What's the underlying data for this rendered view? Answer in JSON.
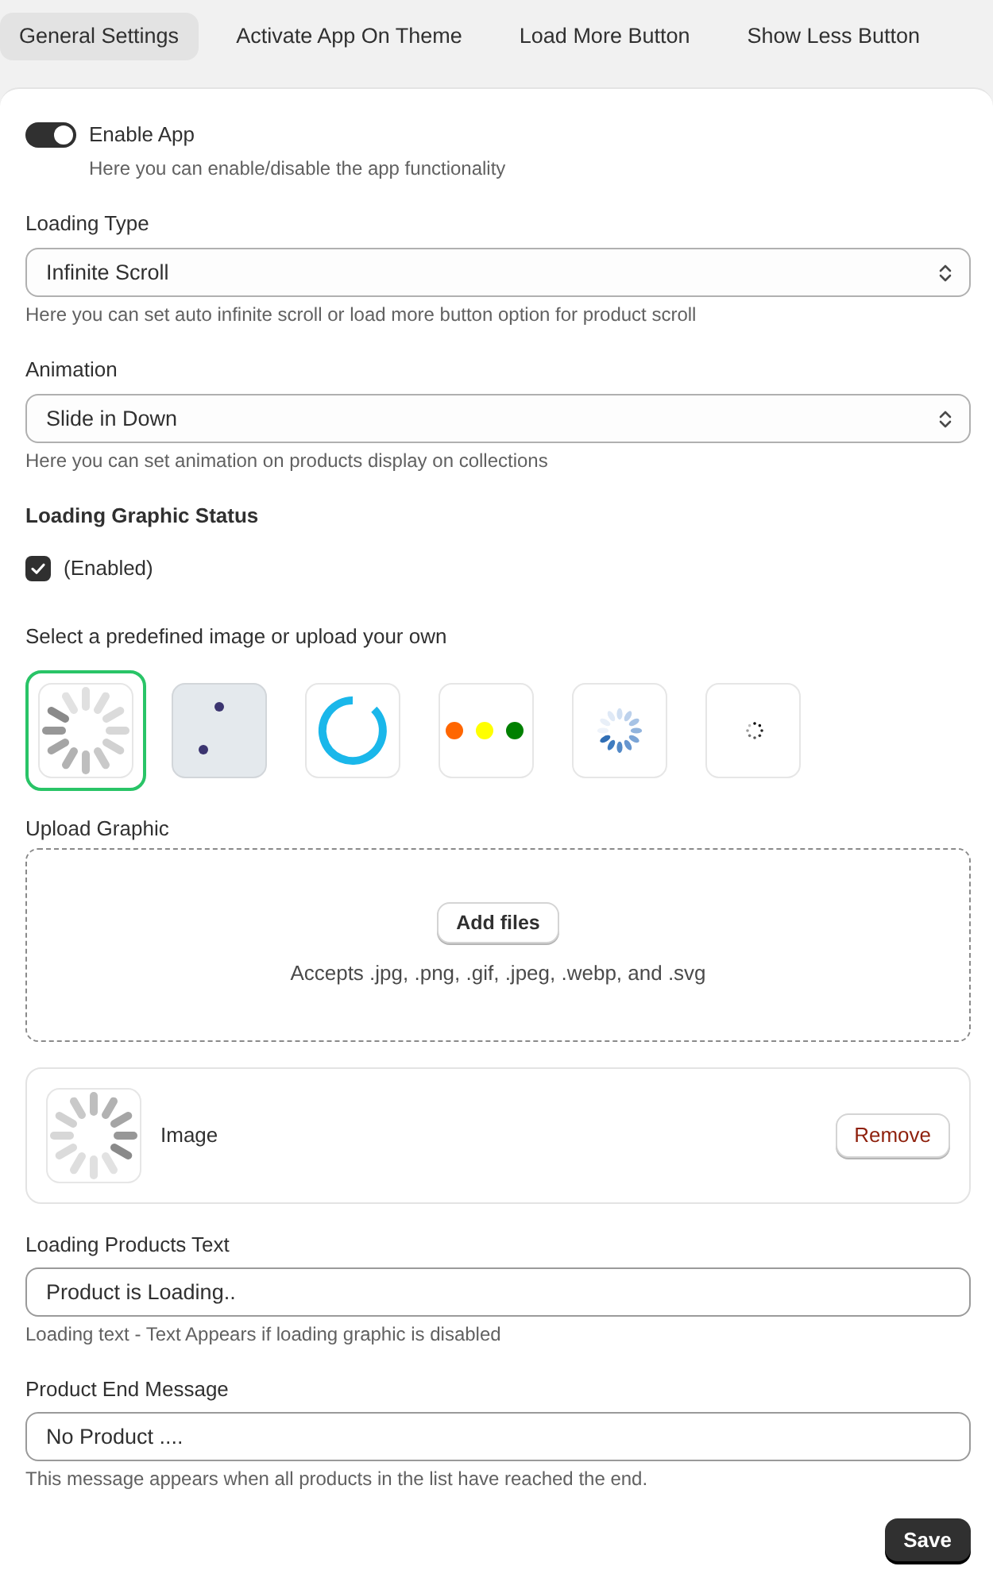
{
  "tabs": [
    {
      "label": "General Settings",
      "selected": true
    },
    {
      "label": "Activate App On Theme",
      "selected": false
    },
    {
      "label": "Load More Button",
      "selected": false
    },
    {
      "label": "Show Less Button",
      "selected": false
    }
  ],
  "enable_app": {
    "label": "Enable App",
    "on": true,
    "help": "Here you can enable/disable the app functionality"
  },
  "loading_type": {
    "label": "Loading Type",
    "value": "Infinite Scroll",
    "help": "Here you can set auto infinite scroll or load more button option for product scroll"
  },
  "animation": {
    "label": "Animation",
    "value": "Slide in Down",
    "help": "Here you can set animation on products display on collections"
  },
  "loading_graphic_status": {
    "label": "Loading Graphic Status",
    "checkbox_label": "(Enabled)",
    "checked": true
  },
  "predefined_images": {
    "label": "Select a predefined image or upload your own",
    "items": [
      {
        "kind": "spokes",
        "selected": true
      },
      {
        "kind": "two-dots",
        "selected": false
      },
      {
        "kind": "ring",
        "selected": false
      },
      {
        "kind": "three-dots",
        "selected": false
      },
      {
        "kind": "petals",
        "selected": false
      },
      {
        "kind": "dotted-circle",
        "selected": false
      }
    ]
  },
  "upload_graphic": {
    "label": "Upload Graphic",
    "button": "Add files",
    "hint": "Accepts .jpg, .png, .gif, .jpeg, .webp, and .svg"
  },
  "uploaded_file": {
    "name": "Image",
    "button": "Remove"
  },
  "loading_products_text": {
    "label": "Loading Products Text",
    "value": "Product is Loading..",
    "help": "Loading text - Text Appears if loading graphic is disabled"
  },
  "product_end_message": {
    "label": "Product End Message",
    "value": "No Product ....",
    "help": "This message appears when all products in the list have reached the end."
  },
  "save_button": "Save"
}
